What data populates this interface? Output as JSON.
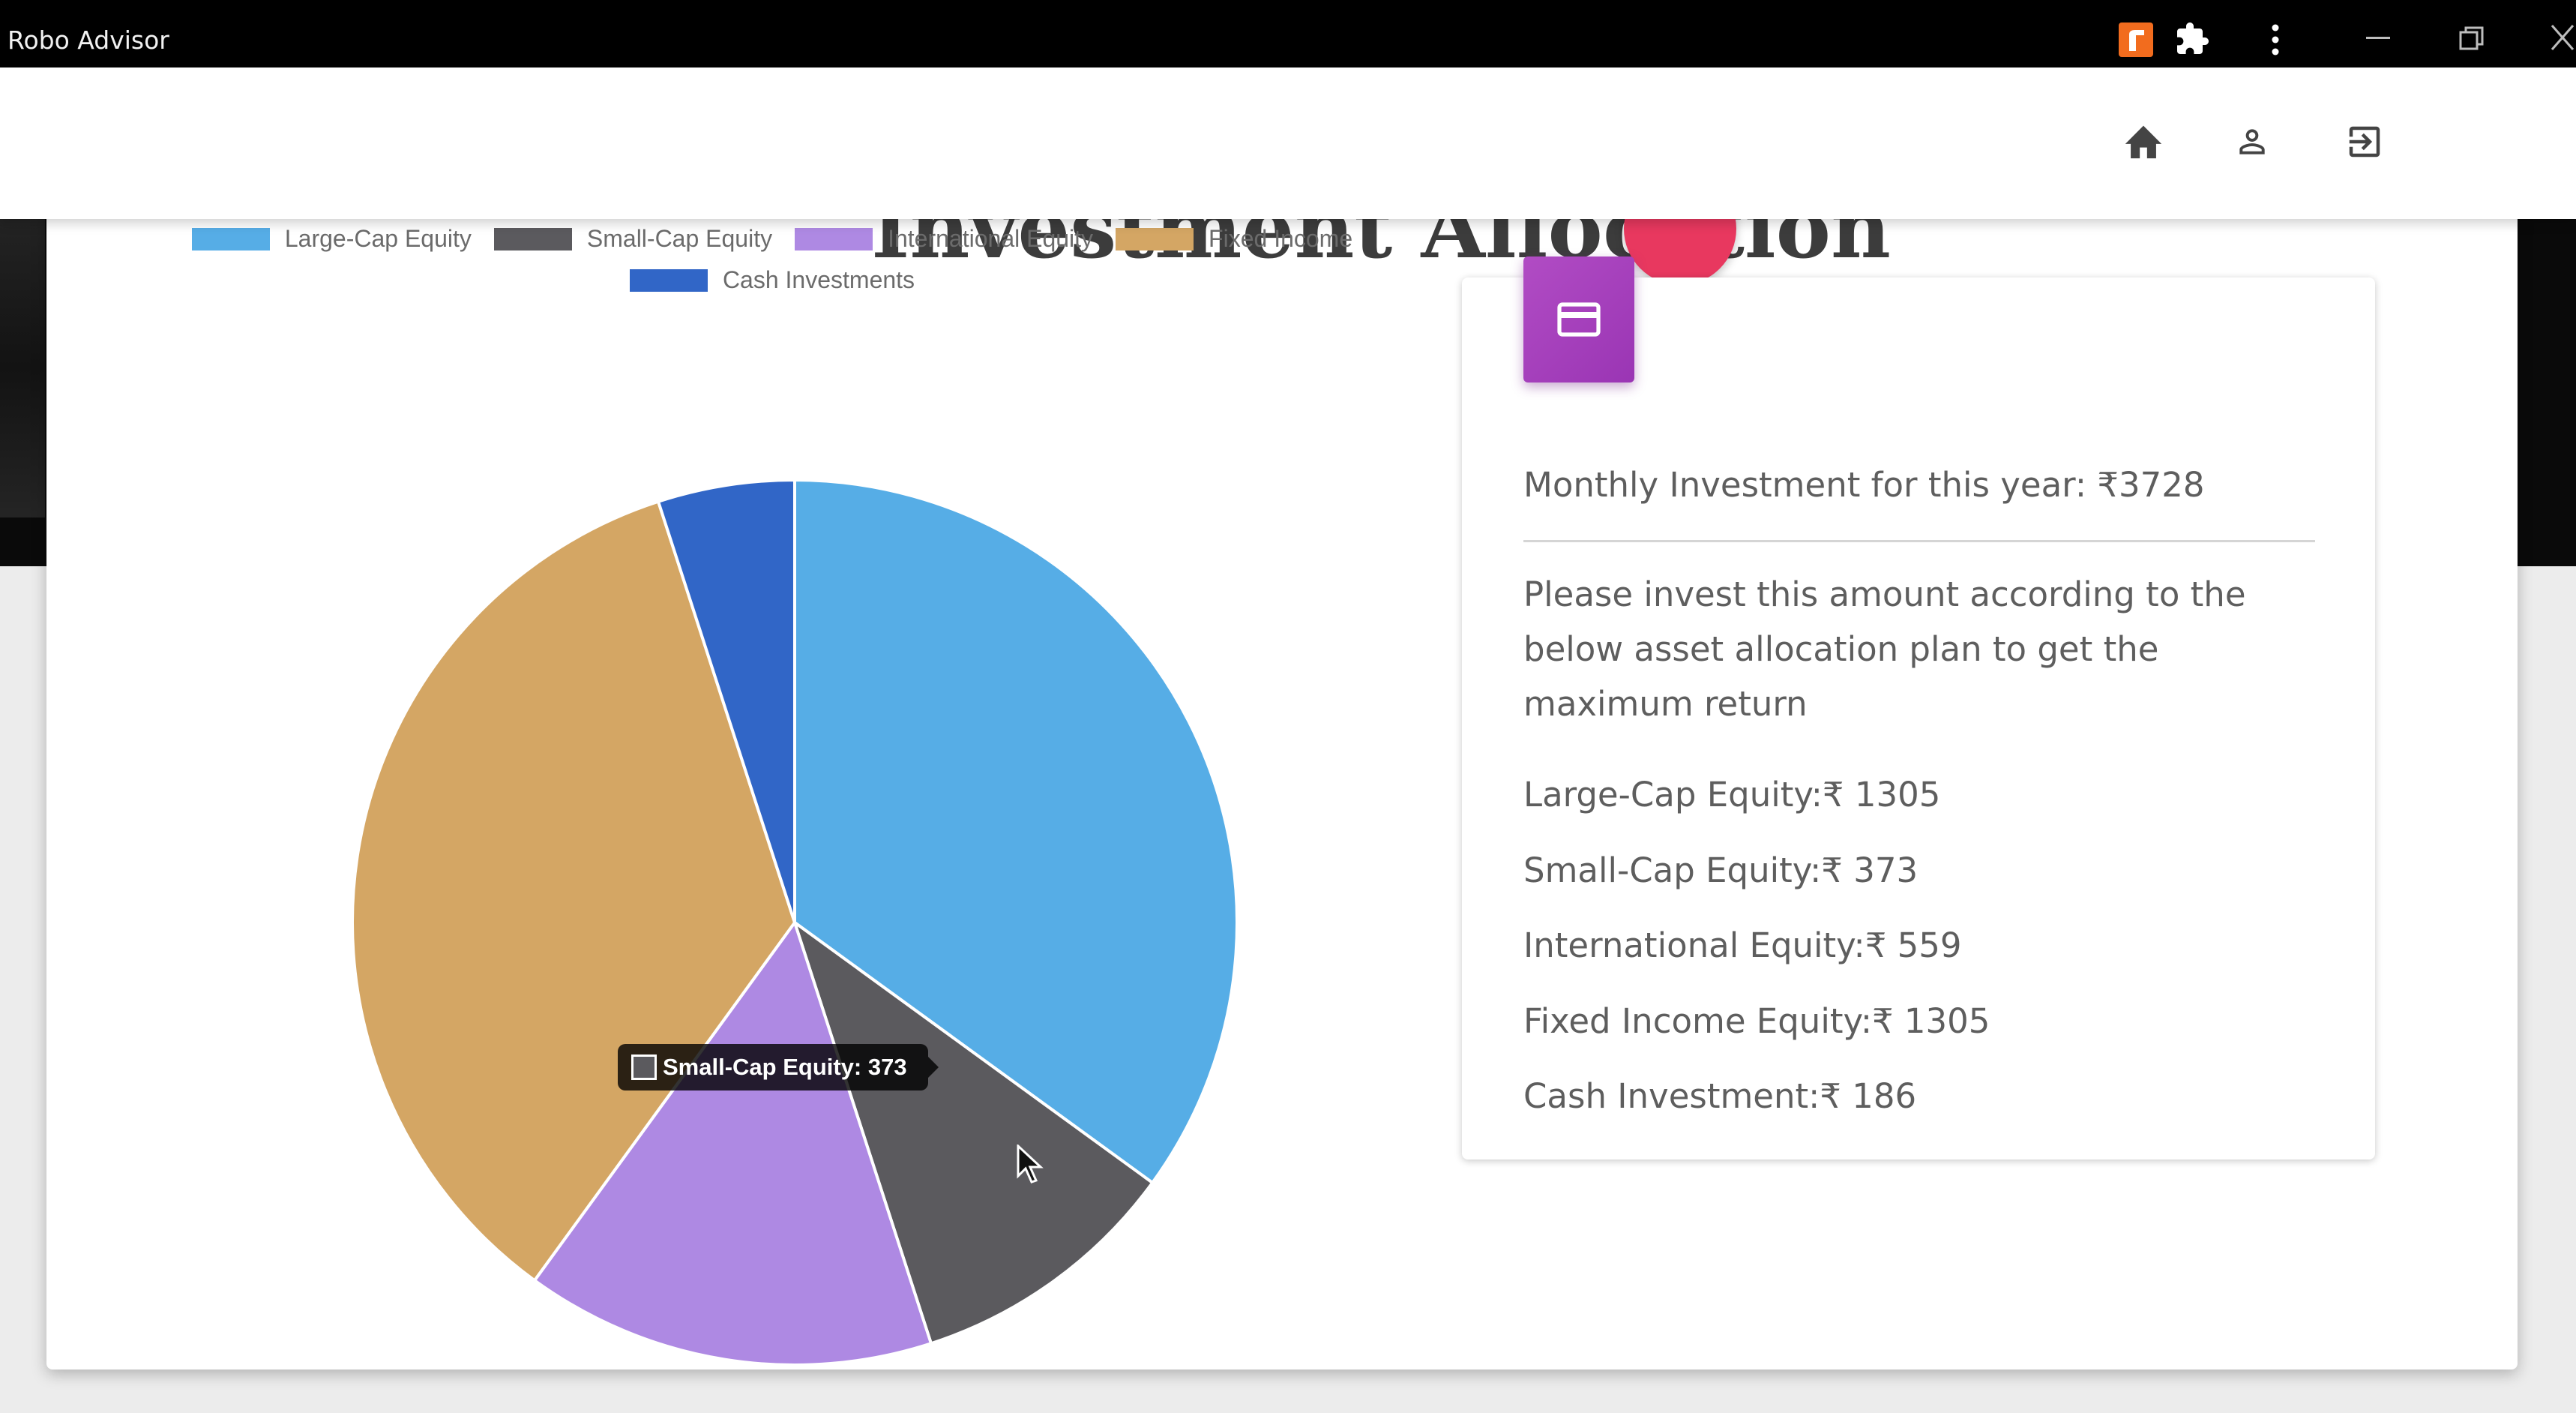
{
  "window": {
    "title": "Robo Advisor",
    "controls": [
      "minimize-icon",
      "restore-icon",
      "close-icon"
    ],
    "extensions": [
      "extension-r-icon",
      "puzzle-icon",
      "more-vert-icon"
    ]
  },
  "header": {
    "nav": [
      {
        "name": "home-button",
        "icon": "home-icon"
      },
      {
        "name": "profile-button",
        "icon": "person-icon"
      },
      {
        "name": "logout-button",
        "icon": "logout-icon"
      }
    ]
  },
  "page": {
    "partial_title": "Investment Allocation"
  },
  "chart_data": {
    "type": "pie",
    "legend": [
      "Large-Cap Equity",
      "Small-Cap Equity",
      "International Equity",
      "Fixed Income",
      "Cash Investments"
    ],
    "legend_position": "top",
    "series": [
      {
        "label": "Large-Cap Equity",
        "value": 1305,
        "color": "#56ade6"
      },
      {
        "label": "Small-Cap Equity",
        "value": 373,
        "color": "#5b5a5e"
      },
      {
        "label": "International Equity",
        "value": 559,
        "color": "#ae89e3"
      },
      {
        "label": "Fixed Income",
        "value": 1305,
        "color": "#d4a664"
      },
      {
        "label": "Cash Investments",
        "value": 186,
        "color": "#3166c7"
      }
    ],
    "tooltip": "Small-Cap Equity: 373"
  },
  "info_card": {
    "icon": "credit-card-icon",
    "monthly": "Monthly Investment for this year: ₹3728",
    "instruction": "Please invest this amount according to the below asset allocation plan to get the maximum return",
    "allocations": [
      "Large-Cap Equity:₹ 1305",
      "Small-Cap Equity:₹ 373",
      "International Equity:₹ 559",
      "Fixed Income Equity:₹ 1305",
      "Cash Investment:₹ 186"
    ]
  },
  "colors": {
    "accent_purple": "#a13fbc",
    "fab_red": "#e8385f"
  }
}
